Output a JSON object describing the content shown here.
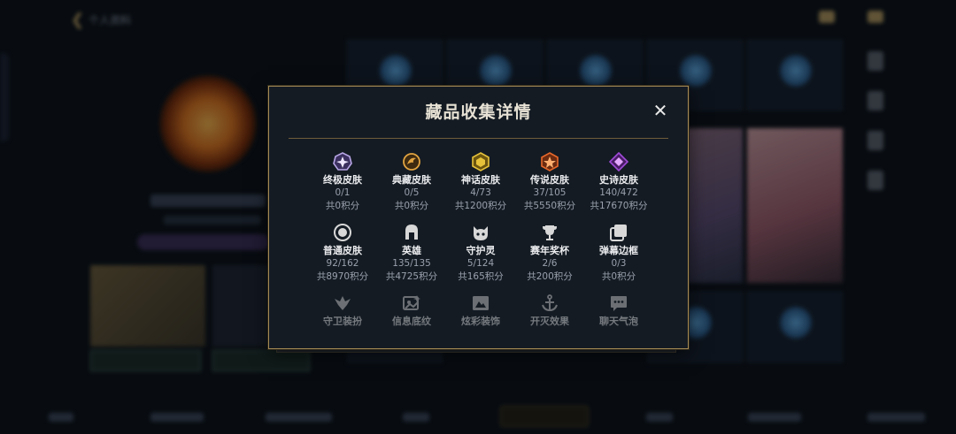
{
  "background": {
    "title": "个人资料",
    "back_icon": "chevron-left-icon"
  },
  "modal": {
    "title": "藏品收集详情",
    "close_icon": "close-icon",
    "close_label": "✕",
    "rows": [
      [
        {
          "icon": "ultimate-skin-icon",
          "label": "终极皮肤",
          "count": "0/1",
          "points": "共0积分",
          "color": "#b8a6e6"
        },
        {
          "icon": "collector-skin-icon",
          "label": "典藏皮肤",
          "count": "0/5",
          "points": "共0积分",
          "color": "#e2a441"
        },
        {
          "icon": "mythic-skin-icon",
          "label": "神话皮肤",
          "count": "4/73",
          "points": "共1200积分",
          "color": "#e6c23a"
        },
        {
          "icon": "legendary-skin-icon",
          "label": "传说皮肤",
          "count": "37/105",
          "points": "共5550积分",
          "color": "#e8682a"
        },
        {
          "icon": "epic-skin-icon",
          "label": "史诗皮肤",
          "count": "140/472",
          "points": "共17670积分",
          "color": "#a04ad8"
        }
      ],
      [
        {
          "icon": "normal-skin-icon",
          "label": "普通皮肤",
          "count": "92/162",
          "points": "共8970积分",
          "color": "#d8d8d8"
        },
        {
          "icon": "hero-helmet-icon",
          "label": "英雄",
          "count": "135/135",
          "points": "共4725积分",
          "color": "#d8d8d8"
        },
        {
          "icon": "guardian-spirit-icon",
          "label": "守护灵",
          "count": "5/124",
          "points": "共165积分",
          "color": "#d8d8d8"
        },
        {
          "icon": "trophy-icon",
          "label": "赛年奖杯",
          "count": "2/6",
          "points": "共200积分",
          "color": "#d8d8d8"
        },
        {
          "icon": "barrage-frame-icon",
          "label": "弹幕边框",
          "count": "0/3",
          "points": "共0积分",
          "color": "#d8d8d8"
        }
      ],
      [
        {
          "icon": "guard-badge-icon",
          "label": "守卫装扮",
          "color": "#d8d8d8"
        },
        {
          "icon": "info-card-icon",
          "label": "信息底纹",
          "color": "#d8d8d8"
        },
        {
          "icon": "portrait-frame-icon",
          "label": "炫彩装饰",
          "color": "#d8d8d8"
        },
        {
          "icon": "anchor-icon",
          "label": "开灭效果",
          "color": "#d8d8d8"
        },
        {
          "icon": "chat-bubble-icon",
          "label": "聊天气泡",
          "color": "#d8d8d8"
        }
      ]
    ]
  }
}
